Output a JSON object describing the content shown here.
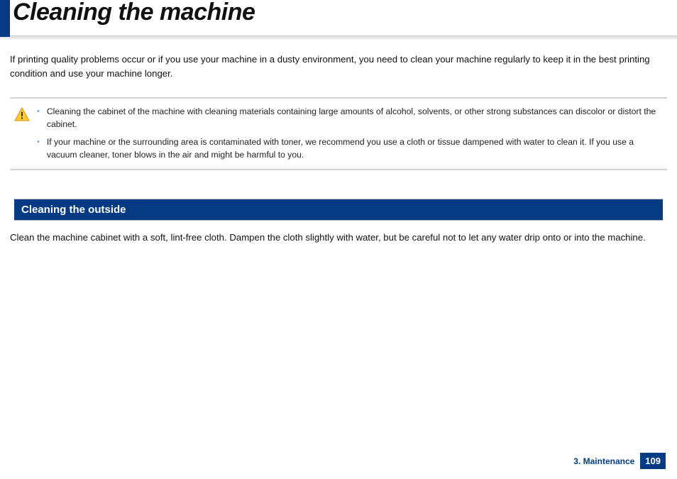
{
  "title": "Cleaning the machine",
  "intro": "If printing quality problems occur or if you use your machine in a dusty environment, you need to clean your machine regularly to keep it in the best printing condition and use your machine longer.",
  "warning": {
    "items": [
      "Cleaning the cabinet of the machine with cleaning materials containing large amounts of alcohol, solvents, or other strong substances can discolor or distort the cabinet.",
      "If your machine or the surrounding area is contaminated with toner, we recommend you use a cloth or tissue dampened with water to clean it. If you use a vacuum cleaner, toner blows in the air and might be harmful to you."
    ]
  },
  "section": {
    "heading": "Cleaning the outside",
    "body": "Clean the machine cabinet with a soft, lint-free cloth. Dampen the cloth slightly with water, but be careful not to let any water drip onto or into the machine."
  },
  "footer": {
    "chapter": "3. Maintenance",
    "page": "109"
  }
}
